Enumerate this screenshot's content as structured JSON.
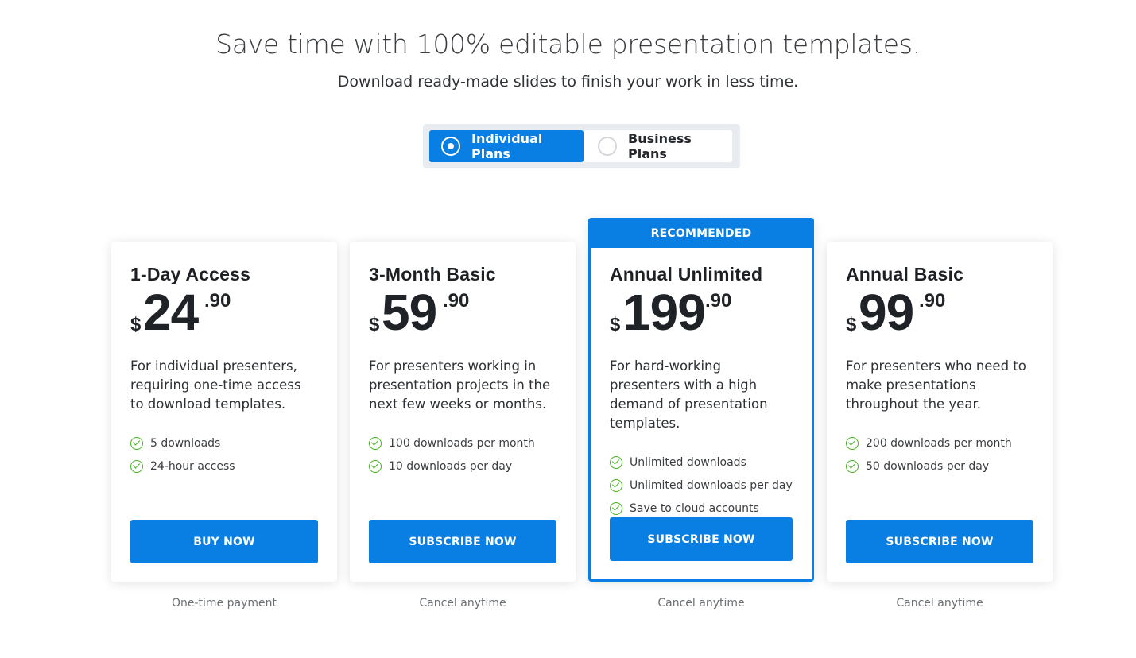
{
  "header": {
    "title": "Save time with 100% editable presentation templates.",
    "subtitle": "Download ready-made slides to finish your work in less time."
  },
  "plan_toggle": {
    "options": [
      {
        "label": "Individual Plans",
        "selected": true
      },
      {
        "label": "Business Plans",
        "selected": false
      }
    ]
  },
  "colors": {
    "accent": "#0a7fe3",
    "check": "#44b31d"
  },
  "plans": [
    {
      "name": "1-Day Access",
      "currency": "$",
      "price_whole": "24",
      "price_cents": ".90",
      "description": "For individual presenters, requiring one-time access to download templates.",
      "features": [
        "5 downloads",
        "24-hour access"
      ],
      "button": "BUY NOW",
      "footnote": "One-time payment"
    },
    {
      "name": "3-Month Basic",
      "currency": "$",
      "price_whole": "59",
      "price_cents": ".90",
      "description": "For presenters working in presentation projects in the next few weeks or months.",
      "features": [
        "100 downloads per month",
        "10 downloads per day"
      ],
      "button": "SUBSCRIBE NOW",
      "footnote": "Cancel anytime"
    },
    {
      "badge": "RECOMMENDED",
      "name": "Annual Unlimited",
      "currency": "$",
      "price_whole": "199",
      "price_cents": ".90",
      "description": "For hard-working presenters with a high demand of presentation templates.",
      "features": [
        "Unlimited downloads",
        "Unlimited downloads per day",
        "Save to cloud accounts"
      ],
      "button": "SUBSCRIBE NOW",
      "footnote": "Cancel anytime"
    },
    {
      "name": "Annual Basic",
      "currency": "$",
      "price_whole": "99",
      "price_cents": ".90",
      "description": "For presenters who need to make presentations throughout the year.",
      "features": [
        "200 downloads per month",
        "50 downloads per day"
      ],
      "button": "SUBSCRIBE NOW",
      "footnote": "Cancel anytime"
    }
  ]
}
